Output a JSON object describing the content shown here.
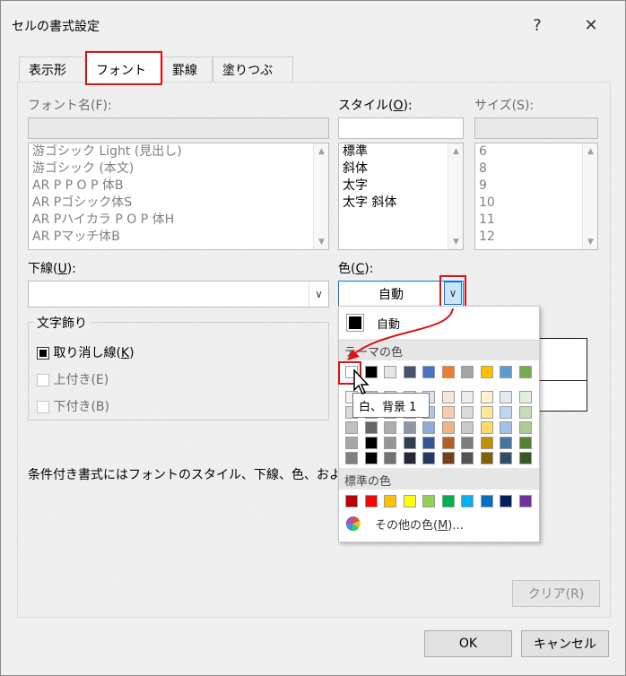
{
  "window": {
    "title": "セルの書式設定",
    "help_label": "?",
    "close_label": "✕"
  },
  "tabs": [
    {
      "label": "表示形式"
    },
    {
      "label": "フォント"
    },
    {
      "label": "罫線"
    },
    {
      "label": "塗りつぶし"
    }
  ],
  "font_name": {
    "label_pre": "フォント名(",
    "label_key": "F",
    "label_post": "):",
    "value": "",
    "items": [
      "游ゴシック Light (見出し)",
      "游ゴシック (本文)",
      "AR P P O P 体B",
      "AR Pゴシック体S",
      "AR Pハイカラ P O P 体H",
      "AR Pマッチ体B"
    ]
  },
  "style": {
    "label_pre": "スタイル(",
    "label_key": "O",
    "label_post": "):",
    "value": "",
    "items": [
      "標準",
      "斜体",
      "太字",
      "太字 斜体"
    ]
  },
  "size": {
    "label_pre": "サイズ(",
    "label_key": "S",
    "label_post": "):",
    "value": "",
    "items": [
      "6",
      "8",
      "9",
      "10",
      "11",
      "12"
    ]
  },
  "underline": {
    "label_pre": "下線(",
    "label_key": "U",
    "label_post": "):",
    "value": ""
  },
  "color": {
    "label_pre": "色(",
    "label_key": "C",
    "label_post": "):",
    "value": "自動"
  },
  "effects": {
    "title": "文字飾り",
    "strikethrough_pre": "取り消し線(",
    "strikethrough_key": "K",
    "strikethrough_post": ")",
    "superscript": "上付き(E)",
    "subscript": "下付き(B)"
  },
  "note": "条件付き書式にはフォントのスタイル、下線、色、および取",
  "color_popup": {
    "auto_label": "自動",
    "theme_title": "テーマの色",
    "standard_title": "標準の色",
    "more_colors_pre": "その他の色(",
    "more_colors_key": "M",
    "more_colors_post": ")...",
    "tooltip": "白、背景 1",
    "theme_colors": [
      "#ffffff",
      "#000000",
      "#e7e6e6",
      "#44546a",
      "#4472c4",
      "#ed7d31",
      "#a5a5a5",
      "#ffc000",
      "#5b9bd5",
      "#70ad47"
    ],
    "standard_colors": [
      "#c00000",
      "#ff0000",
      "#ffc000",
      "#ffff00",
      "#92d050",
      "#00b050",
      "#00b0f0",
      "#0070c0",
      "#002060",
      "#7030a0"
    ]
  },
  "buttons": {
    "clear": "クリア(R)",
    "ok": "OK",
    "cancel": "キャンセル"
  }
}
